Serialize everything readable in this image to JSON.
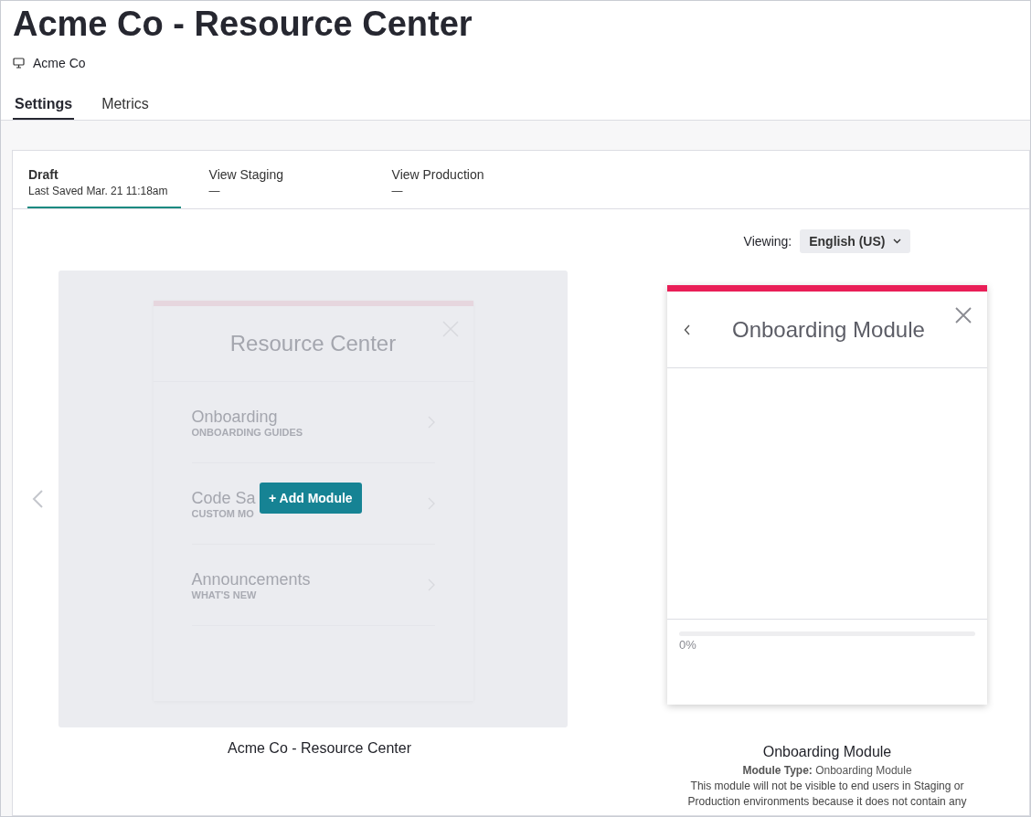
{
  "page": {
    "title": "Acme Co - Resource Center",
    "app": "Acme Co"
  },
  "tabs": [
    {
      "label": "Settings",
      "selected": true
    },
    {
      "label": "Metrics",
      "selected": false
    }
  ],
  "env_tabs": [
    {
      "label": "Draft",
      "sub": "Last Saved Mar. 21 11:18am",
      "selected": true
    },
    {
      "label": "View Staging",
      "sub": "—",
      "selected": false
    },
    {
      "label": "View Production",
      "sub": "—",
      "selected": false
    }
  ],
  "viewing": {
    "label": "Viewing:",
    "value": "English (US)"
  },
  "preview": {
    "title": "Resource Center",
    "items": [
      {
        "title": "Onboarding",
        "sub": "ONBOARDING GUIDES"
      },
      {
        "title": "Code Sa",
        "sub": "CUSTOM MO"
      },
      {
        "title": "Announcements",
        "sub": "WHAT'S NEW"
      }
    ],
    "button": "+ Add Module",
    "caption": "Acme Co - Resource Center"
  },
  "module": {
    "title": "Onboarding Module",
    "progress": {
      "level": 0,
      "reading": "0%"
    },
    "caption": "Onboarding Module",
    "type": "**Module Type:** Onboarding Module",
    "description": "This module will not be visible to end users in Staging or Production environments because it does not contain any"
  }
}
